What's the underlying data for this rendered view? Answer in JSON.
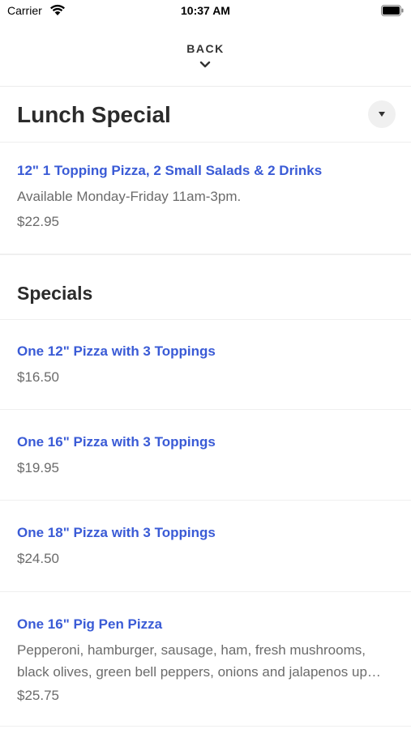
{
  "status_bar": {
    "carrier": "Carrier",
    "time": "10:37 AM"
  },
  "header": {
    "back_label": "BACK"
  },
  "lunch_special": {
    "title": "Lunch Special",
    "items": [
      {
        "name": "12\" 1 Topping Pizza, 2 Small Salads & 2 Drinks",
        "description": "Available Monday-Friday 11am-3pm.",
        "price": "$22.95"
      }
    ]
  },
  "specials": {
    "title": "Specials",
    "items": [
      {
        "name": "One 12\" Pizza with 3 Toppings",
        "price": "$16.50"
      },
      {
        "name": "One 16\" Pizza with 3 Toppings",
        "price": "$19.95"
      },
      {
        "name": "One 18\" Pizza with 3 Toppings",
        "price": "$24.50"
      },
      {
        "name": "One 16\" Pig Pen Pizza",
        "description": "Pepperoni, hamburger, sausage, ham, fresh mushrooms, black olives, green bell peppers, onions and jalapenos up…",
        "price": "$25.75"
      }
    ]
  },
  "colors": {
    "item_name": "#3a5bd6",
    "secondary_text": "#6b6b6b",
    "divider": "#efefef"
  }
}
